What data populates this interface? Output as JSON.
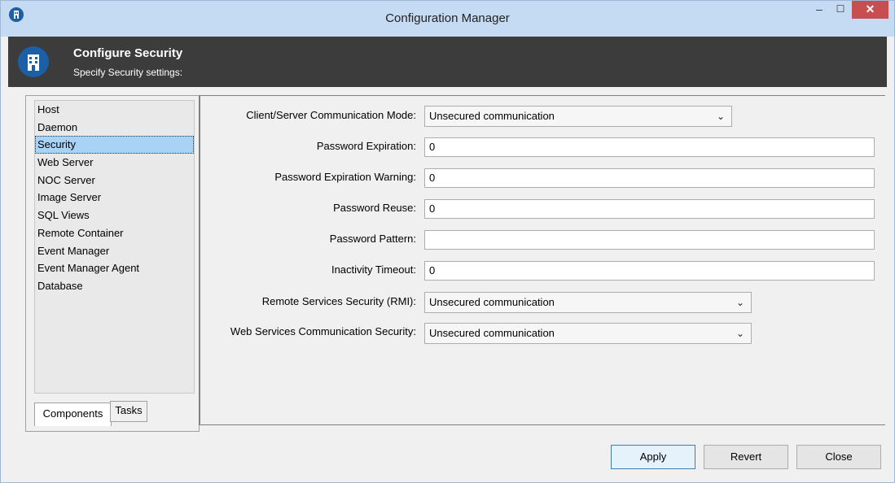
{
  "window": {
    "title": "Configuration Manager",
    "minimize_glyph": "–",
    "maximize_glyph": "☐",
    "close_glyph": "✕"
  },
  "header": {
    "title": "Configure Security",
    "subtitle": "Specify Security settings:"
  },
  "sidebar": {
    "items": [
      {
        "label": "Host",
        "selected": false
      },
      {
        "label": "Daemon",
        "selected": false
      },
      {
        "label": "Security",
        "selected": true
      },
      {
        "label": "Web Server",
        "selected": false
      },
      {
        "label": "NOC Server",
        "selected": false
      },
      {
        "label": "Image Server",
        "selected": false
      },
      {
        "label": "SQL Views",
        "selected": false
      },
      {
        "label": "Remote Container",
        "selected": false
      },
      {
        "label": "Event Manager",
        "selected": false
      },
      {
        "label": "Event Manager Agent",
        "selected": false
      },
      {
        "label": "Database",
        "selected": false
      }
    ],
    "tabs": [
      {
        "label": "Components",
        "active": true
      },
      {
        "label": "Tasks",
        "active": false
      }
    ]
  },
  "form": {
    "client_server_mode": {
      "label": "Client/Server Communication Mode:",
      "value": "Unsecured communication"
    },
    "password_expiration": {
      "label": "Password Expiration:",
      "value": "0"
    },
    "password_expiration_warning": {
      "label": "Password Expiration Warning:",
      "value": "0"
    },
    "password_reuse": {
      "label": "Password Reuse:",
      "value": "0"
    },
    "password_pattern": {
      "label": "Password Pattern:",
      "value": ""
    },
    "inactivity_timeout": {
      "label": "Inactivity Timeout:",
      "value": "0"
    },
    "remote_services_security": {
      "label": "Remote Services Security (RMI):",
      "value": "Unsecured communication"
    },
    "web_services_security": {
      "label": "Web Services Communication Security:",
      "value": "Unsecured communication"
    }
  },
  "footer": {
    "apply_label": "Apply",
    "revert_label": "Revert",
    "close_label": "Close"
  },
  "colors": {
    "titlebar": "#c4dbf3",
    "header_bg": "#3c3c3c",
    "brand_blue": "#1b5fa7",
    "selection": "#a9d3f5",
    "close_button": "#c74f50"
  }
}
